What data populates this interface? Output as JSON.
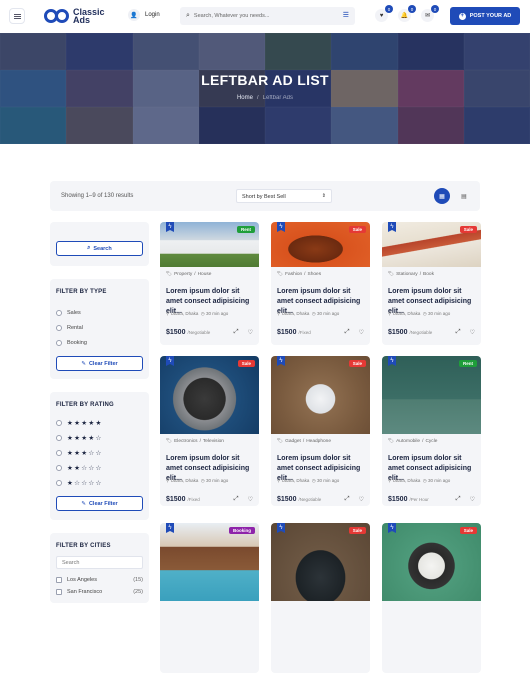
{
  "header": {
    "logo_line1": "Classic",
    "logo_line2": "Ads",
    "login_label": "Login",
    "search_placeholder": "Search, Whatever you needs...",
    "favorites_count": "0",
    "notifications_count": "0",
    "messages_count": "0",
    "post_button_label": "POST YOUR AD",
    "accent_color": "#1f4bb8"
  },
  "hero": {
    "title": "LEFTBAR AD LIST",
    "breadcrumb_home": "Home",
    "breadcrumb_current": "Leftbar Ads"
  },
  "toolbar": {
    "showing_text": "Showing 1–9 of 130 results",
    "sort_value": "Short by Best Sell",
    "view_mode": "grid"
  },
  "sidebar": {
    "search_button": "Search",
    "type_title": "FILTER BY TYPE",
    "types": [
      "Sales",
      "Rental",
      "Booking"
    ],
    "type_clear": "Clear Filter",
    "rating_title": "FILTER BY RATING",
    "ratings": [
      5,
      4,
      3,
      2,
      1
    ],
    "rating_clear": "Clear Filter",
    "cities_title": "FILTER BY CITIES",
    "cities_placeholder": "Search",
    "cities": [
      {
        "name": "Los Angeles",
        "count": "(15)"
      },
      {
        "name": "San Francisco",
        "count": "(25)"
      }
    ]
  },
  "cards": [
    {
      "tag": "Rent",
      "tag_color": "#1f9e3a",
      "category": "Property",
      "subcategory": "House",
      "title": "Lorem ipsum dolor sit amet consect adipisicing elit...",
      "location": "Uttara, Dhaka",
      "time": "30 min ago",
      "price": "$1500",
      "price_note": "/Negotiable"
    },
    {
      "tag": "Sale",
      "tag_color": "#e53935",
      "category": "Fashion",
      "subcategory": "Shoes",
      "title": "Lorem ipsum dolor sit amet consect adipisicing elit...",
      "location": "Uttara, Dhaka",
      "time": "30 min ago",
      "price": "$1500",
      "price_note": "/Fixed"
    },
    {
      "tag": "Sale",
      "tag_color": "#e53935",
      "category": "Stationary",
      "subcategory": "Book",
      "title": "Lorem ipsum dolor sit amet consect adipisicing elit...",
      "location": "Uttara, Dhaka",
      "time": "30 min ago",
      "price": "$1500",
      "price_note": "/Negotiable"
    },
    {
      "tag": "Sale",
      "tag_color": "#e53935",
      "category": "Electronics",
      "subcategory": "Television",
      "title": "Lorem ipsum dolor sit amet consect adipisicing elit...",
      "location": "Uttara, Dhaka",
      "time": "30 min ago",
      "price": "$1500",
      "price_note": "/Fixed"
    },
    {
      "tag": "Sale",
      "tag_color": "#e53935",
      "category": "Gadget",
      "subcategory": "Headphone",
      "title": "Lorem ipsum dolor sit amet consect adipisicing elit...",
      "location": "Uttara, Dhaka",
      "time": "30 min ago",
      "price": "$1500",
      "price_note": "/Negotiable"
    },
    {
      "tag": "Rent",
      "tag_color": "#1f9e3a",
      "category": "Automobile",
      "subcategory": "Cycle",
      "title": "Lorem ipsum dolor sit amet consect adipisicing elit...",
      "location": "Uttara, Dhaka",
      "time": "30 min ago",
      "price": "$1500",
      "price_note": "/Per Hour"
    },
    {
      "tag": "Booking",
      "tag_color": "#8e24aa"
    },
    {
      "tag": "Sale",
      "tag_color": "#e53935"
    },
    {
      "tag": "Sale",
      "tag_color": "#e53935"
    }
  ]
}
